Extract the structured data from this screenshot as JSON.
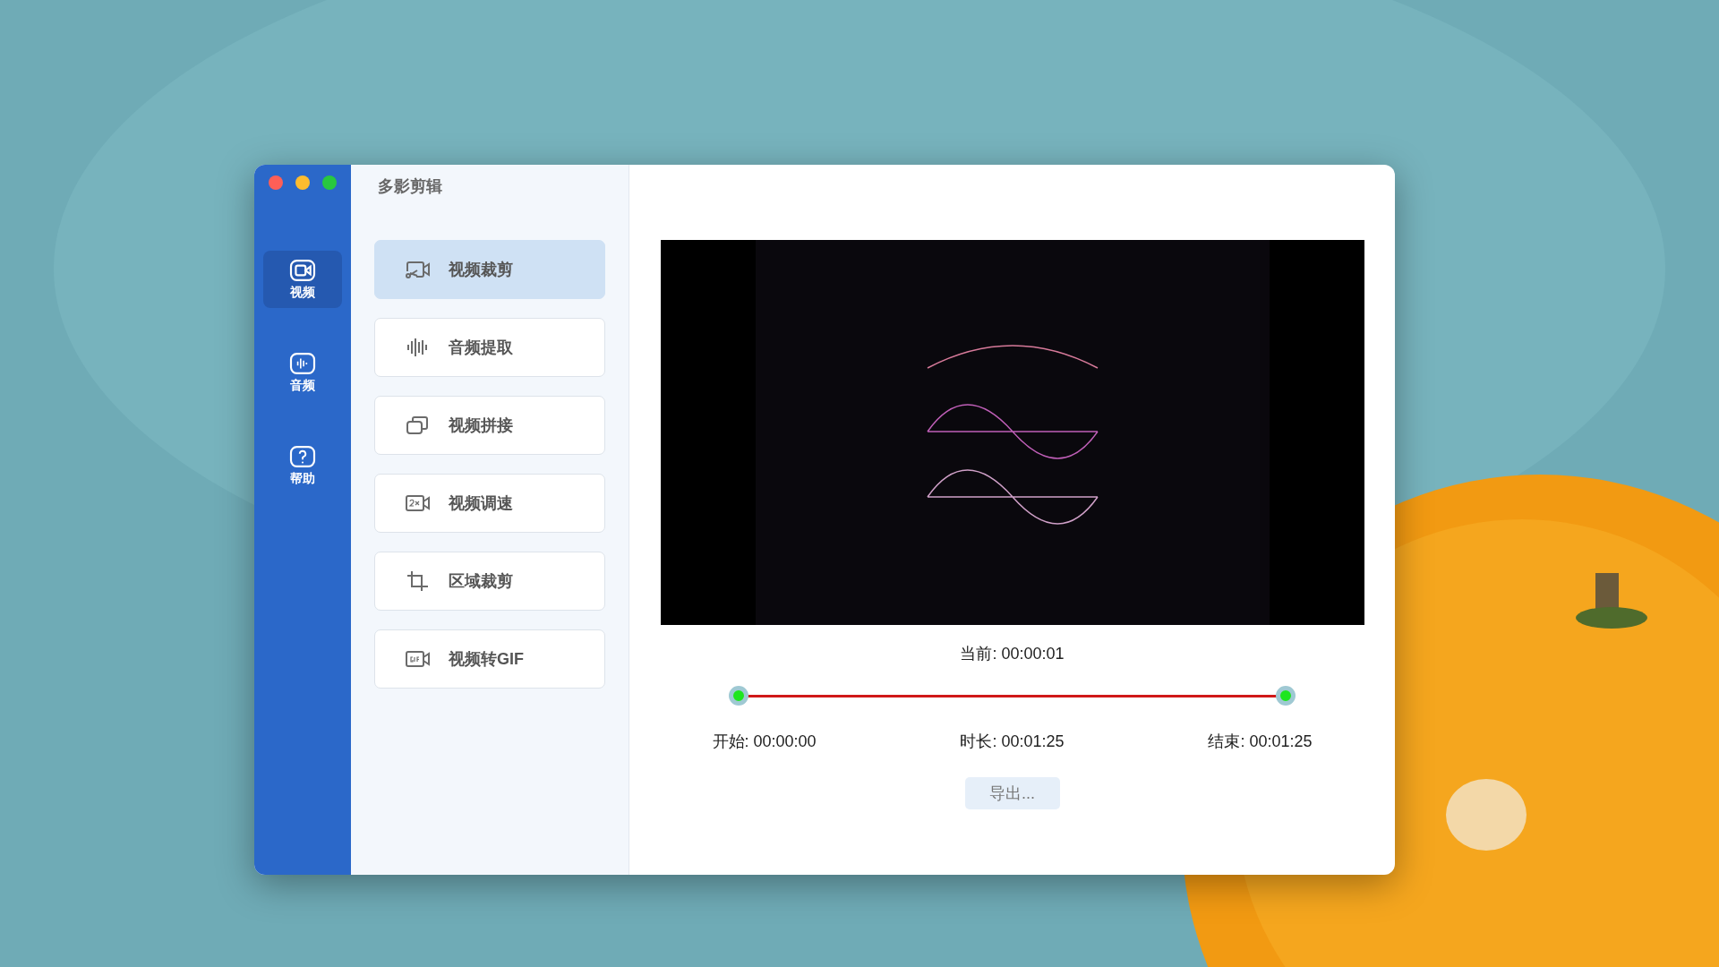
{
  "app_title": "多影剪辑",
  "nav": [
    {
      "label": "视频",
      "kind": "video",
      "selected": true
    },
    {
      "label": "音频",
      "kind": "audio",
      "selected": false
    },
    {
      "label": "帮助",
      "kind": "help",
      "selected": false
    }
  ],
  "tools": [
    {
      "label": "视频裁剪",
      "kind": "cut",
      "selected": true
    },
    {
      "label": "音频提取",
      "kind": "wave",
      "selected": false
    },
    {
      "label": "视频拼接",
      "kind": "merge",
      "selected": false
    },
    {
      "label": "视频调速",
      "kind": "speed",
      "selected": false
    },
    {
      "label": "区域裁剪",
      "kind": "crop",
      "selected": false
    },
    {
      "label": "视频转GIF",
      "kind": "gif",
      "selected": false
    }
  ],
  "current": "当前: 00:00:01",
  "trim": {
    "handles": [
      {
        "level": 0
      },
      {
        "level": 1
      }
    ]
  },
  "start": "开始: 00:00:00",
  "duration": "时长: 00:01:25",
  "end": "结束: 00:01:25",
  "export_button": "导出..."
}
